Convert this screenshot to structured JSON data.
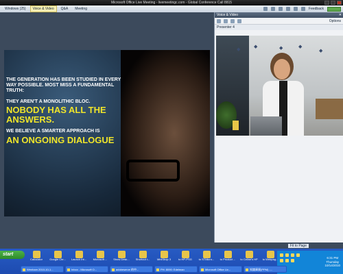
{
  "window": {
    "title": "Microsoft Office Live Meeting - livemeetingc.com - Global Conference Call 8815"
  },
  "menubar": {
    "tabs": [
      {
        "label": "Windows (25)"
      },
      {
        "label": "Voice & Video"
      },
      {
        "label": "Q&A"
      },
      {
        "label": "Meeting"
      }
    ],
    "feedback_label": "Feedback"
  },
  "slide": {
    "line1": "THE GENERATION HAS BEEN STUDIED IN EVERY WAY POSSIBLE. MOST MISS A FUNDAMENTAL TRUTH:",
    "line2": "THEY AREN'T A MONOLITHIC BLOC.",
    "highlight1": "NOBODY HAS ALL THE ANSWERS.",
    "line3": "WE BELIEVE A SMARTER APPROACH IS",
    "highlight2": "AN ONGOING DIALOGUE"
  },
  "voice_video": {
    "title": "Voice & Video",
    "options_label": "Options",
    "presenter_label": "Presenter 4"
  },
  "quickbar": {
    "zoom_label": "Fit to Page"
  },
  "desktop": {
    "icons": [
      {
        "label": "Calculator"
      },
      {
        "label": "Google Chr..."
      },
      {
        "label": "Launch Int..."
      },
      {
        "label": "Microsoft ..."
      },
      {
        "label": "Show Desk..."
      },
      {
        "label": "Shortcut t..."
      },
      {
        "label": "MiniShop 3"
      },
      {
        "label": "to HP-PSG"
      },
      {
        "label": "to STMicro..."
      },
      {
        "label": "to Product ..."
      },
      {
        "label": "to Celine's HP"
      },
      {
        "label": "to Webpag..."
      }
    ]
  },
  "taskbar": {
    "start_label": "start",
    "tasks": [
      {
        "label": "Wenham 2010-10-1..."
      },
      {
        "label": "Inbox - Microsoft O..."
      },
      {
        "label": "adobeserve 的中..."
      },
      {
        "label": "PH: 8090: Edelman"
      },
      {
        "label": "Microsoft Office Liv..."
      },
      {
        "label": "知識庫資(PPM) -..."
      }
    ],
    "clock": {
      "time": "6:31 PM",
      "day": "Thursday",
      "date": "10/14/2010"
    },
    "tray_label": "HP-PSG"
  }
}
